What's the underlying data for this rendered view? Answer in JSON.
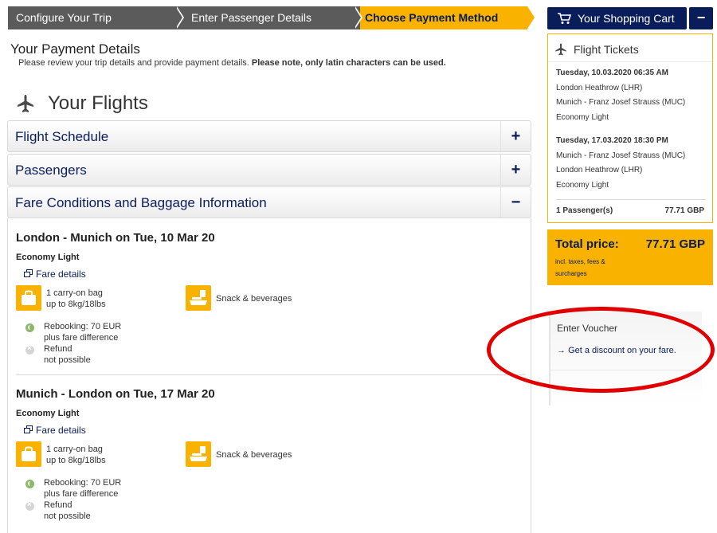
{
  "steps": [
    "Configure Your Trip",
    "Enter Passenger Details",
    "Choose Payment Method"
  ],
  "payment": {
    "title": "Your Payment Details",
    "subtitle_plain": "Please review your trip details and provide payment details. ",
    "subtitle_bold": "Please note, only latin characters can be used."
  },
  "flights_title": "Your Flights",
  "accordion": {
    "schedule": "Flight Schedule",
    "passengers": "Passengers",
    "fare": "Fare Conditions and Baggage Information",
    "plus": "+",
    "minus": "−"
  },
  "segments": [
    {
      "title": "London - Munich on Tue, 10 Mar 20",
      "fare_class": "Economy Light",
      "fare_link": "Fare details",
      "bag_line1": "1 carry-on bag",
      "bag_line2": "up to 8kg/18lbs",
      "snack": "Snack & beverages",
      "rebook_line1": "Rebooking: 70 EUR",
      "rebook_line2": "plus fare difference",
      "refund_line1": "Refund",
      "refund_line2": "not possible"
    },
    {
      "title": "Munich - London on Tue, 17 Mar 20",
      "fare_class": "Economy Light",
      "fare_link": "Fare details",
      "bag_line1": "1 carry-on bag",
      "bag_line2": "up to 8kg/18lbs",
      "snack": "Snack & beverages",
      "rebook_line1": "Rebooking: 70 EUR",
      "rebook_line2": "plus fare difference",
      "refund_line1": "Refund",
      "refund_line2": "not possible"
    }
  ],
  "cart": {
    "label": "Your Shopping Cart",
    "collapse": "−",
    "icon": "shopping-cart-icon"
  },
  "tickets": {
    "title": "Flight Tickets",
    "outbound_date": "Tuesday, 10.03.2020 06:35 AM",
    "outbound_from": "London Heathrow (LHR)",
    "outbound_to": "Munich - Franz Josef Strauss (MUC)",
    "outbound_class": "Economy Light",
    "return_date": "Tuesday, 17.03.2020 18:30 PM",
    "return_from": "Munich - Franz Josef Strauss (MUC)",
    "return_to": "London Heathrow (LHR)",
    "return_class": "Economy Light",
    "passengers": "1 Passenger(s)",
    "price": "77.71 GBP"
  },
  "total": {
    "label": "Total price:",
    "amount": "77.71 GBP",
    "note": "incl. taxes, fees & surcharges"
  },
  "voucher": {
    "title": "Enter Voucher",
    "link": "Get a discount on your fare.",
    "arrow": "→"
  },
  "colors": {
    "brand_navy": "#0a1d5b",
    "accent_yellow": "#f9b200",
    "step_grey": "#5b5b5b",
    "highlight_red": "#e00000"
  }
}
